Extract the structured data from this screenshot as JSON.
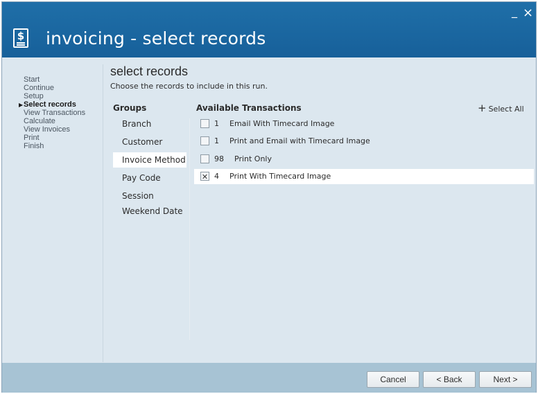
{
  "window": {
    "title": "invoicing - select records",
    "icon": "dollar-document-icon",
    "minimize_glyph": "_",
    "close_glyph": "×"
  },
  "steps": [
    {
      "label": "Start",
      "active": false
    },
    {
      "label": "Continue",
      "active": false
    },
    {
      "label": "Setup",
      "active": false
    },
    {
      "label": "Select records",
      "active": true
    },
    {
      "label": "View Transactions",
      "active": false
    },
    {
      "label": "Calculate",
      "active": false
    },
    {
      "label": "View Invoices",
      "active": false
    },
    {
      "label": "Print",
      "active": false
    },
    {
      "label": "Finish",
      "active": false
    }
  ],
  "main": {
    "title": "select records",
    "subtitle": "Choose the records to include in this run.",
    "groups_header": "Groups",
    "transactions_header": "Available Transactions",
    "select_all_label": "Select All",
    "groups": [
      {
        "label": "Branch",
        "selected": false
      },
      {
        "label": "Customer",
        "selected": false
      },
      {
        "label": "Invoice Method",
        "selected": true
      },
      {
        "label": "Pay Code",
        "selected": false
      },
      {
        "label": "Session",
        "selected": false
      },
      {
        "label": "Weekend Date",
        "selected": false
      }
    ],
    "transactions": [
      {
        "count": "1",
        "label": "Email With Timecard Image",
        "checked": false
      },
      {
        "count": "1",
        "label": "Print and Email with Timecard Image",
        "checked": false
      },
      {
        "count": "98",
        "label": "Print Only",
        "checked": false
      },
      {
        "count": "4",
        "label": "Print With Timecard Image",
        "checked": true
      }
    ]
  },
  "footer": {
    "cancel_label": "Cancel",
    "back_label": "< Back",
    "next_label": "Next >"
  },
  "colors": {
    "titlebar": "#1f6fa8",
    "content_bg": "#dce7ef",
    "footer_bg": "#a7c3d4",
    "selected_row": "#ffffff"
  }
}
